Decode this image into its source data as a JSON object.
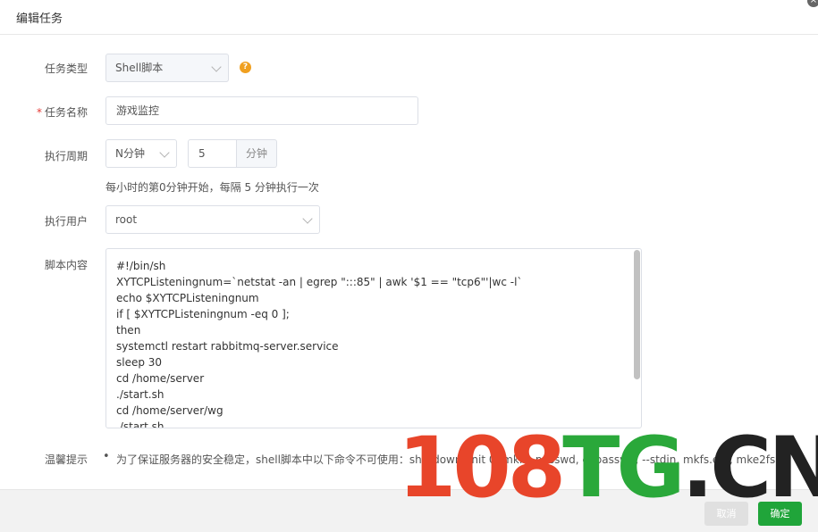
{
  "dialog": {
    "title": "编辑任务"
  },
  "form": {
    "task_type": {
      "label": "任务类型",
      "value": "Shell脚本"
    },
    "task_name": {
      "label": "任务名称",
      "required_mark": "*",
      "value": "游戏监控"
    },
    "period": {
      "label": "执行周期",
      "unit_select": "N分钟",
      "value": "5",
      "suffix": "分钟",
      "hint": "每小时的第0分钟开始，每隔 5 分钟执行一次"
    },
    "user": {
      "label": "执行用户",
      "value": "root"
    },
    "script": {
      "label": "脚本内容",
      "lines": [
        "#!/bin/sh",
        "XYTCPListeningnum=`netstat -an | egrep \":::85\" | awk '$1 == \"tcp6\"'|wc -l`",
        "echo $XYTCPListeningnum",
        "if [ $XYTCPListeningnum -eq 0 ];",
        "then",
        "systemctl restart rabbitmq-server.service",
        "sleep 30",
        "cd /home/server",
        "./start.sh",
        "cd /home/server/wg",
        "./start.sh"
      ]
    },
    "tips": {
      "label": "温馨提示",
      "text": "为了保证服务器的安全稳定，shell脚本中以下命令不可使用：shutdown, init 0, mkfs, passwd, chpasswd, --stdin, mkfs.ext, mke2fs"
    }
  },
  "footer": {
    "cancel_label": "取消",
    "ok_label": "确定"
  },
  "watermark": {
    "num": "108",
    "tg": "TG",
    "dot": ".",
    "cn": "CN"
  },
  "colors": {
    "accent": "#20a53a",
    "help": "#f0a020",
    "required": "#e53935"
  }
}
